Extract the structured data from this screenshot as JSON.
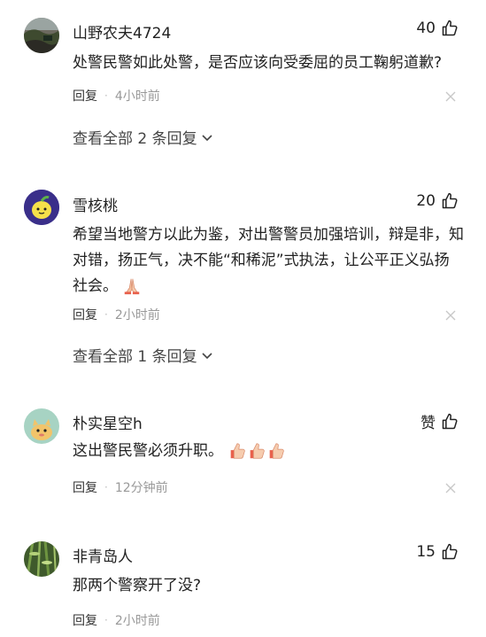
{
  "comments": [
    {
      "username": "山野农夫4724",
      "likes": "40",
      "content": "处警民警如此处警，是否应该向受委屈的员工鞠躬道歉?",
      "reply_label": "回复",
      "time": "4小时前",
      "view_all": "查看全部 2 条回复",
      "avatar_icon": "landscape-photo-avatar"
    },
    {
      "username": "雪核桃",
      "likes": "20",
      "content": "希望当地警方以此为鉴，对出警警员加强培训，辩是非，知对错，扬正气，决不能“和稀泥”式执法，让公平正义弘扬社会。",
      "emoji": "praying-hands-emoji",
      "reply_label": "回复",
      "time": "2小时前",
      "view_all": "查看全部 1 条回复",
      "avatar_icon": "lemon-cartoon-avatar"
    },
    {
      "username": "朴实星空h",
      "likes": "赞",
      "content": "这出警民警必须升职。",
      "emoji": "thumbs-up-emoji",
      "emoji_count": 3,
      "reply_label": "回复",
      "time": "12分钟前",
      "avatar_icon": "cartoon-cat-avatar"
    },
    {
      "username": "非青岛人",
      "likes": "15",
      "content": "那两个警察开了没?",
      "reply_label": "回复",
      "time": "2小时前",
      "avatar_icon": "bamboo-photo-avatar"
    }
  ],
  "colors": {
    "text": "#222222",
    "meta": "#999999",
    "view_all": "#444444",
    "avatar_lemon_bg": "#3a2f8a",
    "avatar_cat_bg": "#a7d3c3"
  }
}
